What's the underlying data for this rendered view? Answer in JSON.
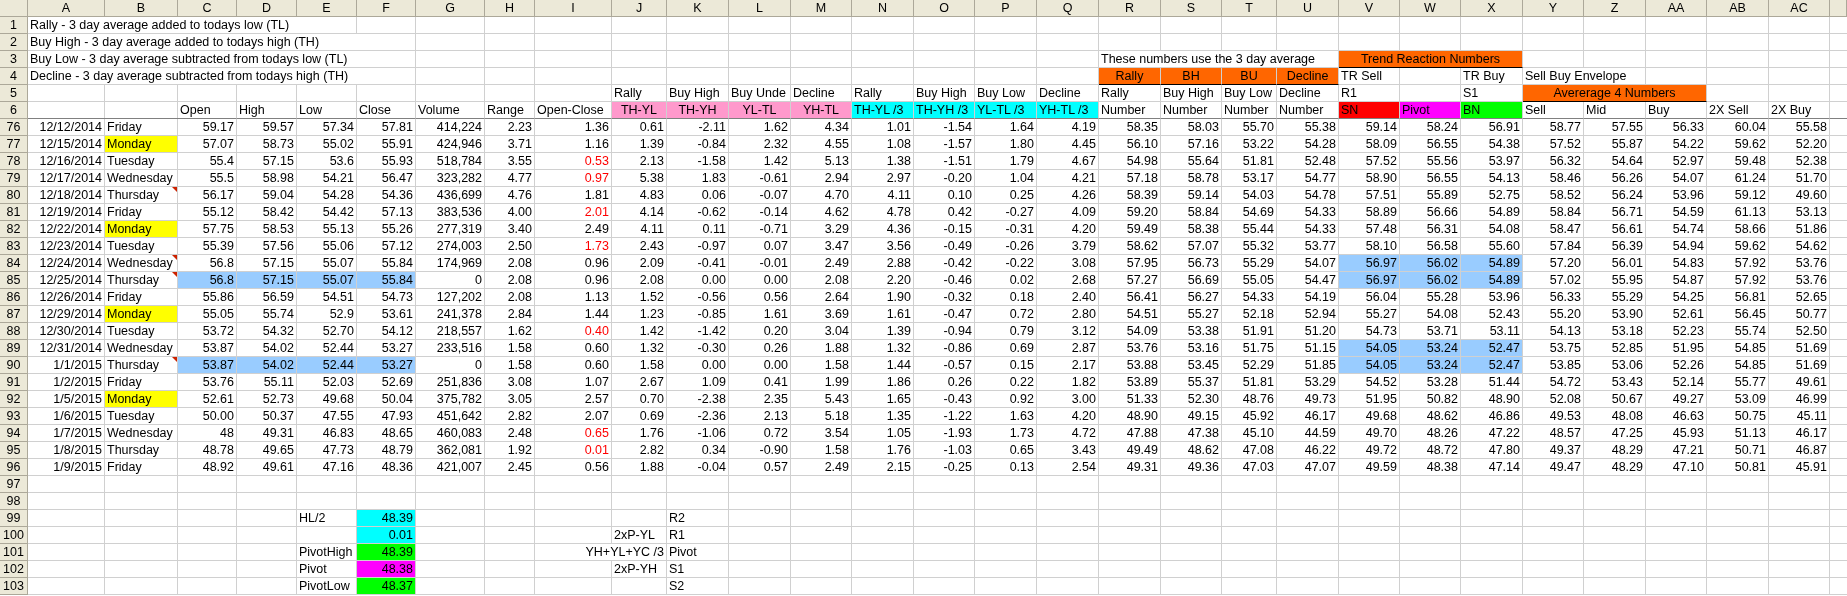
{
  "columns": [
    "A",
    "B",
    "C",
    "D",
    "E",
    "F",
    "G",
    "H",
    "I",
    "J",
    "K",
    "L",
    "M",
    "N",
    "O",
    "P",
    "Q",
    "R",
    "S",
    "T",
    "U",
    "V",
    "W",
    "X",
    "Y",
    "Z",
    "AA",
    "AB",
    "AC"
  ],
  "rows": [
    {
      "number": "1",
      "kind": "plain",
      "cells": {
        "A": "Rally - 3 day average added to todays low (TL)"
      }
    },
    {
      "number": "2",
      "kind": "plain",
      "cells": {
        "A": "Buy High - 3 day average added to todays high (TH)"
      }
    },
    {
      "number": "3",
      "kind": "plain",
      "cells": {
        "A": "Buy Low - 3 day average subtracted from todays low (TL)",
        "R": "These numbers use the 3 day average",
        "V": {
          "text": "Trend Reaction Numbers",
          "kind": "heading",
          "color": "#ff6600"
        }
      }
    },
    {
      "number": "4",
      "kind": "plain",
      "cells": {
        "A": "Decline - 3 day average subtracted from todays high (TH)",
        "R": {
          "text": "Rally",
          "kind": "heading",
          "color": "#ff6600"
        },
        "S": {
          "text": "BH",
          "kind": "heading",
          "color": "#ff6600"
        },
        "T": {
          "text": "BU",
          "kind": "heading",
          "color": "#ff6600"
        },
        "U": {
          "text": "Decline",
          "kind": "heading",
          "color": "#ff6600"
        },
        "V": "TR Sell",
        "X": "TR Buy",
        "Y": "Sell Buy Envelope"
      }
    },
    {
      "number": "5",
      "kind": "plain",
      "cells": {
        "J": "Rally",
        "K": "Buy High",
        "L": "Buy Unde",
        "M": "Decline",
        "N": "Rally",
        "O": "Buy High",
        "P": "Buy Low",
        "Q": "Decline",
        "R": "Rally",
        "S": "Buy High",
        "T": "Buy Low",
        "U": "Decline",
        "V": "R1",
        "X": "S1",
        "Y": {
          "text": "Avererage 4 Numbers",
          "kind": "heading",
          "color": "#ff6600"
        }
      }
    },
    {
      "number": "6",
      "kind": "header",
      "cells": {
        "C": "Open",
        "D": "High",
        "E": "Low",
        "F": "Close",
        "G": "Volume",
        "H": "Range",
        "I": "Open-Close",
        "J": {
          "text": "TH-YL",
          "kind": "centered",
          "color": "#ff99cc"
        },
        "K": {
          "text": "TH-YH",
          "kind": "centered",
          "color": "#ff99cc"
        },
        "L": {
          "text": "YL-TL",
          "kind": "centered",
          "color": "#ff99cc"
        },
        "M": {
          "text": "YH-TL",
          "kind": "centered",
          "color": "#ff99cc"
        },
        "N": {
          "text": "TH-YL /3",
          "color": "#00ffff"
        },
        "O": {
          "text": "TH-YH /3",
          "color": "#00ffff"
        },
        "P": {
          "text": "YL-TL /3",
          "color": "#00ffff"
        },
        "Q": {
          "text": "YH-TL /3",
          "color": "#00ffff"
        },
        "R": "Number",
        "S": "Number",
        "T": "Number",
        "U": "Number",
        "V": {
          "text": "SN",
          "color": "#ff0000"
        },
        "W": {
          "text": "Pivot",
          "color": "#ff00ff"
        },
        "X": {
          "text": "BN",
          "color": "#00ff00"
        },
        "Y": "Sell",
        "Z": "Mid",
        "AA": "Buy",
        "AB": "2X Sell",
        "AC": "2X Buy"
      }
    },
    {
      "number": "76",
      "kind": "data",
      "values": [
        "12/12/2014",
        "Friday",
        "59.17",
        "59.57",
        "57.34",
        "57.81",
        "414,224",
        "2.23",
        "1.36",
        "0.61",
        "-2.11",
        "1.62",
        "4.34",
        "1.01",
        "-1.54",
        "1.64",
        "4.19",
        "58.35",
        "58.03",
        "55.70",
        "55.38",
        "59.14",
        "58.24",
        "56.91",
        "58.77",
        "57.55",
        "56.33",
        "60.04",
        "55.58"
      ]
    },
    {
      "number": "77",
      "kind": "data",
      "values": [
        "12/15/2014",
        {
          "text": "Monday",
          "color": "#ffff00"
        },
        "57.07",
        "58.73",
        "55.02",
        "55.91",
        "424,946",
        "3.71",
        "1.16",
        "1.39",
        "-0.84",
        "2.32",
        "4.55",
        "1.08",
        "-1.57",
        "1.80",
        "4.45",
        "56.10",
        "57.16",
        "53.22",
        "54.28",
        "58.09",
        "56.55",
        "54.38",
        "57.52",
        "55.87",
        "54.22",
        "59.62",
        "52.20"
      ]
    },
    {
      "number": "78",
      "kind": "data",
      "values": [
        "12/16/2014",
        "Tuesday",
        "55.4",
        "57.15",
        "53.6",
        "55.93",
        "518,784",
        "3.55",
        {
          "text": "0.53",
          "kind": "alert"
        },
        "2.13",
        "-1.58",
        "1.42",
        "5.13",
        "1.38",
        "-1.51",
        "1.79",
        "4.67",
        "54.98",
        "55.64",
        "51.81",
        "52.48",
        "57.52",
        "55.56",
        "53.97",
        "56.32",
        "54.64",
        "52.97",
        "59.48",
        "52.38"
      ]
    },
    {
      "number": "79",
      "kind": "data",
      "values": [
        "12/17/2014",
        "Wednesday",
        "55.5",
        "58.98",
        "54.21",
        "56.47",
        "323,282",
        "4.77",
        {
          "text": "0.97",
          "kind": "alert"
        },
        "5.38",
        "1.83",
        "-0.61",
        "2.94",
        "2.97",
        "-0.20",
        "1.04",
        "4.21",
        "57.18",
        "58.78",
        "53.17",
        "54.77",
        "58.90",
        "56.55",
        "54.13",
        "58.46",
        "56.26",
        "54.07",
        "61.24",
        "51.70"
      ]
    },
    {
      "number": "80",
      "kind": "data",
      "values": [
        "12/18/2014",
        {
          "text": "Thursday",
          "comment": true
        },
        "56.17",
        "59.04",
        "54.28",
        "54.36",
        "436,699",
        "4.76",
        "1.81",
        "4.83",
        "0.06",
        "-0.07",
        "4.70",
        "4.11",
        "0.10",
        "0.25",
        "4.26",
        "58.39",
        "59.14",
        "54.03",
        "54.78",
        "57.51",
        "55.89",
        "52.75",
        "58.52",
        "56.24",
        "53.96",
        "59.12",
        "49.60"
      ]
    },
    {
      "number": "81",
      "kind": "data",
      "values": [
        "12/19/2014",
        "Friday",
        "55.12",
        "58.42",
        "54.42",
        "57.13",
        "383,536",
        "4.00",
        {
          "text": "2.01",
          "kind": "alert"
        },
        "4.14",
        "-0.62",
        "-0.14",
        "4.62",
        "4.78",
        "0.42",
        "-0.27",
        "4.09",
        "59.20",
        "58.84",
        "54.69",
        "54.33",
        "58.89",
        "56.66",
        "54.89",
        "58.84",
        "56.71",
        "54.59",
        "61.13",
        "53.13"
      ]
    },
    {
      "number": "82",
      "kind": "data",
      "values": [
        "12/22/2014",
        {
          "text": "Monday",
          "color": "#ffff00"
        },
        "57.75",
        "58.53",
        "55.13",
        "55.26",
        "277,319",
        "3.40",
        "2.49",
        "4.11",
        "0.11",
        "-0.71",
        "3.29",
        "4.36",
        "-0.15",
        "-0.31",
        "4.20",
        "59.49",
        "58.38",
        "55.44",
        "54.33",
        "57.48",
        "56.31",
        "54.08",
        "58.47",
        "56.61",
        "54.74",
        "58.66",
        "51.86"
      ]
    },
    {
      "number": "83",
      "kind": "data",
      "values": [
        "12/23/2014",
        "Tuesday",
        "55.39",
        "57.56",
        "55.06",
        "57.12",
        "274,003",
        "2.50",
        {
          "text": "1.73",
          "kind": "alert"
        },
        "2.43",
        "-0.97",
        "0.07",
        "3.47",
        "3.56",
        "-0.49",
        "-0.26",
        "3.79",
        "58.62",
        "57.07",
        "55.32",
        "53.77",
        "58.10",
        "56.58",
        "55.60",
        "57.84",
        "56.39",
        "54.94",
        "59.62",
        "54.62"
      ]
    },
    {
      "number": "84",
      "kind": "data",
      "values": [
        "12/24/2014",
        {
          "text": "Wednesday",
          "comment": true
        },
        "56.8",
        "57.15",
        "55.07",
        "55.84",
        "174,969",
        "2.08",
        "0.96",
        "2.09",
        "-0.41",
        "-0.01",
        "2.49",
        "2.88",
        "-0.42",
        "-0.22",
        "3.08",
        "57.95",
        "56.73",
        "55.29",
        "54.07",
        {
          "text": "56.97",
          "color": "#99ccff"
        },
        {
          "text": "56.02",
          "color": "#99ccff"
        },
        {
          "text": "54.89",
          "color": "#99ccff"
        },
        "57.20",
        "56.01",
        "54.83",
        "57.92",
        "53.76"
      ]
    },
    {
      "number": "85",
      "kind": "data",
      "values": [
        "12/25/2014",
        {
          "text": "Thursday",
          "comment": true
        },
        {
          "text": "56.8",
          "color": "#99ccff"
        },
        {
          "text": "57.15",
          "color": "#99ccff"
        },
        {
          "text": "55.07",
          "color": "#99ccff"
        },
        {
          "text": "55.84",
          "color": "#99ccff"
        },
        "0",
        "2.08",
        "0.96",
        "2.08",
        "0.00",
        "0.00",
        "2.08",
        "2.20",
        "-0.46",
        "0.02",
        "2.68",
        "57.27",
        "56.69",
        "55.05",
        "54.47",
        {
          "text": "56.97",
          "color": "#99ccff"
        },
        {
          "text": "56.02",
          "color": "#99ccff"
        },
        {
          "text": "54.89",
          "color": "#99ccff"
        },
        "57.02",
        "55.95",
        "54.87",
        "57.92",
        "53.76"
      ]
    },
    {
      "number": "86",
      "kind": "data",
      "values": [
        "12/26/2014",
        "Friday",
        "55.86",
        "56.59",
        "54.51",
        "54.73",
        "127,202",
        "2.08",
        "1.13",
        "1.52",
        "-0.56",
        "0.56",
        "2.64",
        "1.90",
        "-0.32",
        "0.18",
        "2.40",
        "56.41",
        "56.27",
        "54.33",
        "54.19",
        "56.04",
        "55.28",
        "53.96",
        "56.33",
        "55.29",
        "54.25",
        "56.81",
        "52.65"
      ]
    },
    {
      "number": "87",
      "kind": "data",
      "values": [
        "12/29/2014",
        {
          "text": "Monday",
          "color": "#ffff00"
        },
        "55.05",
        "55.74",
        "52.9",
        "53.61",
        "241,378",
        "2.84",
        "1.44",
        "1.23",
        "-0.85",
        "1.61",
        "3.69",
        "1.61",
        "-0.47",
        "0.72",
        "2.80",
        "54.51",
        "55.27",
        "52.18",
        "52.94",
        "55.27",
        "54.08",
        "52.43",
        "55.20",
        "53.90",
        "52.61",
        "56.45",
        "50.77"
      ]
    },
    {
      "number": "88",
      "kind": "data",
      "values": [
        "12/30/2014",
        "Tuesday",
        "53.72",
        "54.32",
        "52.70",
        "54.12",
        "218,557",
        "1.62",
        {
          "text": "0.40",
          "kind": "alert"
        },
        "1.42",
        "-1.42",
        "0.20",
        "3.04",
        "1.39",
        "-0.94",
        "0.79",
        "3.12",
        "54.09",
        "53.38",
        "51.91",
        "51.20",
        "54.73",
        "53.71",
        "53.11",
        "54.13",
        "53.18",
        "52.23",
        "55.74",
        "52.50"
      ]
    },
    {
      "number": "89",
      "kind": "data",
      "values": [
        "12/31/2014",
        "Wednesday",
        "53.87",
        "54.02",
        "52.44",
        "53.27",
        "233,516",
        "1.58",
        "0.60",
        "1.32",
        "-0.30",
        "0.26",
        "1.88",
        "1.32",
        "-0.86",
        "0.69",
        "2.87",
        "53.76",
        "53.16",
        "51.75",
        "51.15",
        {
          "text": "54.05",
          "color": "#99ccff"
        },
        {
          "text": "53.24",
          "color": "#99ccff"
        },
        {
          "text": "52.47",
          "color": "#99ccff"
        },
        "53.75",
        "52.85",
        "51.95",
        "54.85",
        "51.69"
      ]
    },
    {
      "number": "90",
      "kind": "data",
      "values": [
        "1/1/2015",
        {
          "text": "Thursday",
          "comment": true
        },
        {
          "text": "53.87",
          "color": "#99ccff"
        },
        {
          "text": "54.02",
          "color": "#99ccff"
        },
        {
          "text": "52.44",
          "color": "#99ccff"
        },
        {
          "text": "53.27",
          "color": "#99ccff"
        },
        "0",
        "1.58",
        "0.60",
        "1.58",
        "0.00",
        "0.00",
        "1.58",
        "1.44",
        "-0.57",
        "0.15",
        "2.17",
        "53.88",
        "53.45",
        "52.29",
        "51.85",
        {
          "text": "54.05",
          "color": "#99ccff"
        },
        {
          "text": "53.24",
          "color": "#99ccff"
        },
        {
          "text": "52.47",
          "color": "#99ccff"
        },
        "53.85",
        "53.06",
        "52.26",
        "54.85",
        "51.69"
      ]
    },
    {
      "number": "91",
      "kind": "data",
      "values": [
        "1/2/2015",
        "Friday",
        "53.76",
        "55.11",
        "52.03",
        "52.69",
        "251,836",
        "3.08",
        "1.07",
        "2.67",
        "1.09",
        "0.41",
        "1.99",
        "1.86",
        "0.26",
        "0.22",
        "1.82",
        "53.89",
        "55.37",
        "51.81",
        "53.29",
        "54.52",
        "53.28",
        "51.44",
        "54.72",
        "53.43",
        "52.14",
        "55.77",
        "49.61"
      ]
    },
    {
      "number": "92",
      "kind": "data",
      "values": [
        "1/5/2015",
        {
          "text": "Monday",
          "color": "#ffff00"
        },
        "52.61",
        "52.73",
        "49.68",
        "50.04",
        "375,782",
        "3.05",
        "2.57",
        "0.70",
        "-2.38",
        "2.35",
        "5.43",
        "1.65",
        "-0.43",
        "0.92",
        "3.00",
        "51.33",
        "52.30",
        "48.76",
        "49.73",
        "51.95",
        "50.82",
        "48.90",
        "52.08",
        "50.67",
        "49.27",
        "53.09",
        "46.99"
      ]
    },
    {
      "number": "93",
      "kind": "data",
      "values": [
        "1/6/2015",
        "Tuesday",
        "50.00",
        "50.37",
        "47.55",
        "47.93",
        "451,642",
        "2.82",
        "2.07",
        "0.69",
        "-2.36",
        "2.13",
        "5.18",
        "1.35",
        "-1.22",
        "1.63",
        "4.20",
        "48.90",
        "49.15",
        "45.92",
        "46.17",
        "49.68",
        "48.62",
        "46.86",
        "49.53",
        "48.08",
        "46.63",
        "50.75",
        "45.11"
      ]
    },
    {
      "number": "94",
      "kind": "data",
      "values": [
        "1/7/2015",
        "Wednesday",
        "48",
        "49.31",
        "46.83",
        "48.65",
        "460,083",
        "2.48",
        {
          "text": "0.65",
          "kind": "alert"
        },
        "1.76",
        "-1.06",
        "0.72",
        "3.54",
        "1.05",
        "-1.93",
        "1.73",
        "4.72",
        "47.88",
        "47.38",
        "45.10",
        "44.59",
        "49.70",
        "48.26",
        "47.22",
        "48.57",
        "47.25",
        "45.93",
        "51.13",
        "46.17"
      ]
    },
    {
      "number": "95",
      "kind": "data",
      "values": [
        "1/8/2015",
        "Thursday",
        "48.78",
        "49.65",
        "47.73",
        "48.79",
        "362,081",
        "1.92",
        {
          "text": "0.01",
          "kind": "alert"
        },
        "2.82",
        "0.34",
        "-0.90",
        "1.58",
        "1.76",
        "-1.03",
        "0.65",
        "3.43",
        "49.49",
        "48.62",
        "47.08",
        "46.22",
        "49.72",
        "48.72",
        "47.80",
        "49.37",
        "48.29",
        "47.21",
        "50.71",
        "46.87"
      ]
    },
    {
      "number": "96",
      "kind": "data",
      "values": [
        "1/9/2015",
        "Friday",
        "48.92",
        "49.61",
        "47.16",
        "48.36",
        "421,007",
        "2.45",
        "0.56",
        "1.88",
        "-0.04",
        "0.57",
        "2.49",
        "2.15",
        "-0.25",
        "0.13",
        "2.54",
        "49.31",
        "49.36",
        "47.03",
        "47.07",
        "49.59",
        "48.38",
        "47.14",
        "49.47",
        "48.29",
        "47.10",
        "50.81",
        "45.91"
      ]
    },
    {
      "number": "97",
      "kind": "plain",
      "cells": {}
    },
    {
      "number": "98",
      "kind": "plain",
      "cells": {}
    },
    {
      "number": "99",
      "kind": "plain",
      "cells": {
        "E": "HL/2",
        "F": {
          "text": "48.39",
          "kind": "value",
          "color": "#00ffff"
        },
        "K": "R2"
      }
    },
    {
      "number": "100",
      "kind": "plain",
      "cells": {
        "F": {
          "text": "0.01",
          "kind": "value",
          "color": "#00ffff"
        },
        "J": "2xP-YL",
        "K": "R1"
      }
    },
    {
      "number": "101",
      "kind": "plain",
      "cells": {
        "E": "PivotHigh",
        "F": {
          "text": "48.39",
          "kind": "value",
          "color": "#00ff00"
        },
        "J": {
          "text": "YH+YL+YC /3",
          "kind": "value"
        },
        "K": "Pivot"
      }
    },
    {
      "number": "102",
      "kind": "plain",
      "cells": {
        "E": "Pivot",
        "F": {
          "text": "48.38",
          "kind": "value",
          "color": "#ff00ff"
        },
        "J": "2xP-YH",
        "K": "S1"
      }
    },
    {
      "number": "103",
      "kind": "plain",
      "cells": {
        "E": "PivotLow",
        "F": {
          "text": "48.37",
          "kind": "value",
          "color": "#00ff00"
        },
        "K": "S2"
      }
    }
  ]
}
